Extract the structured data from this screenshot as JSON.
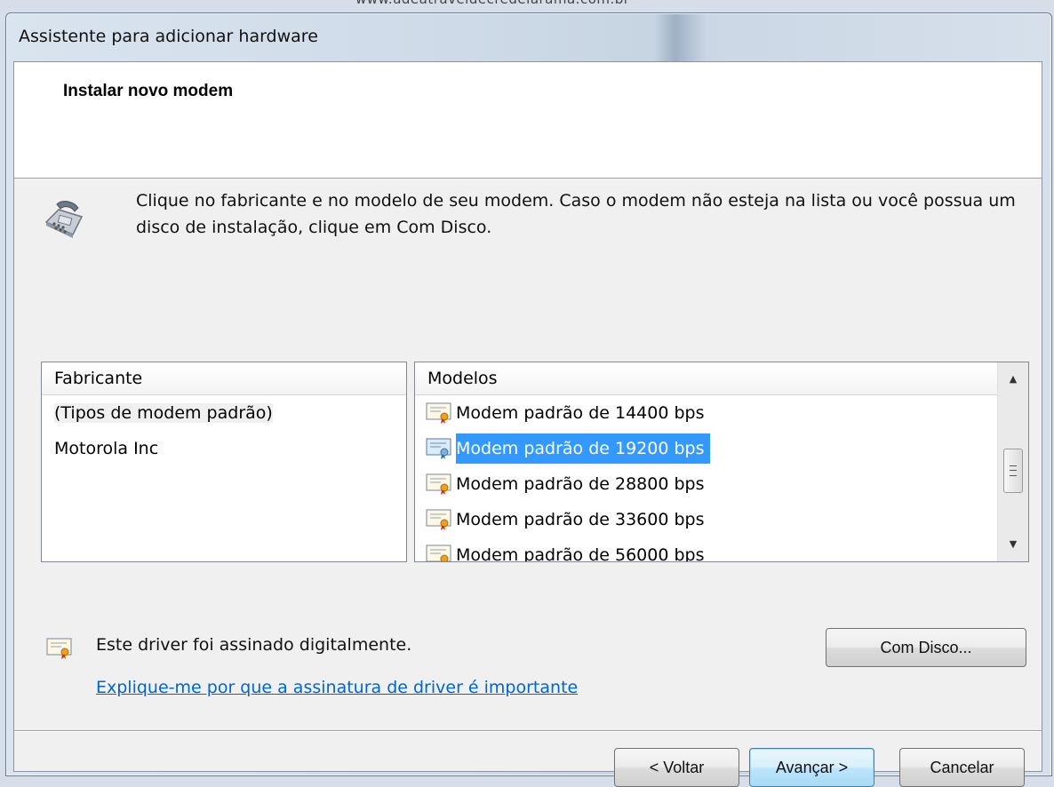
{
  "watermark": "www.adeatraveldecredelarama.com.br",
  "window": {
    "title": "Assistente para adicionar hardware",
    "header_title": "Instalar novo modem",
    "intro": "Clique no fabricante e no modelo de seu modem. Caso o modem não esteja na lista ou você possua um disco de instalação, clique em Com Disco."
  },
  "manufacturers": {
    "header": "Fabricante",
    "items": [
      "(Tipos de modem padrão)",
      "Motorola Inc"
    ],
    "selected_index": 0
  },
  "models": {
    "header": "Modelos",
    "items": [
      "Modem padrão de 14400 bps",
      "Modem padrão de 19200 bps",
      "Modem padrão de 28800 bps",
      "Modem padrão de 33600 bps",
      "Modem padrão de 56000 bps"
    ],
    "selected_index": 1
  },
  "signature": {
    "text": "Este driver foi assinado digitalmente.",
    "link": "Explique-me por que a assinatura de driver é importante"
  },
  "buttons": {
    "have_disk": "Com Disco...",
    "back": "< Voltar",
    "next": "Avançar >",
    "cancel": "Cancelar"
  },
  "colors": {
    "selection": "#3399ff",
    "link": "#0066cc",
    "dialog_bg": "#f0f0f0"
  },
  "icons": {
    "intro": "modem-phone-icon",
    "certificate": "certificate-icon"
  }
}
